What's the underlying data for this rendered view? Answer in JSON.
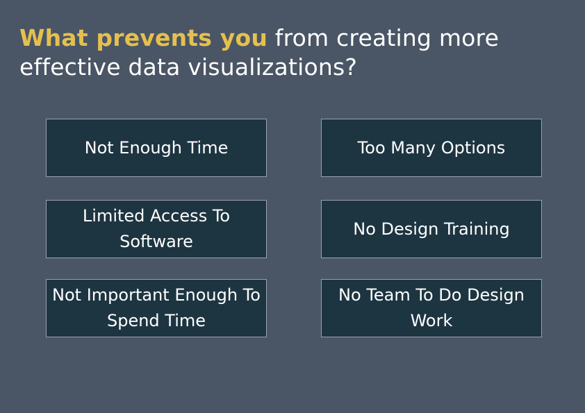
{
  "question": {
    "highlight": "What prevents you",
    "rest": " from creating more effective data visualizations?"
  },
  "options": [
    {
      "label": "Not Enough Time"
    },
    {
      "label": "Too Many Options"
    },
    {
      "label": "Limited Access To Software"
    },
    {
      "label": "No Design Training"
    },
    {
      "label": "Not Important Enough To Spend Time"
    },
    {
      "label": "No Team To Do Design Work"
    }
  ],
  "colors": {
    "background": "#4a5665",
    "highlight": "#e5c04f",
    "box_fill": "#1d3541",
    "box_border": "#9aa3ad",
    "text": "#ffffff"
  }
}
